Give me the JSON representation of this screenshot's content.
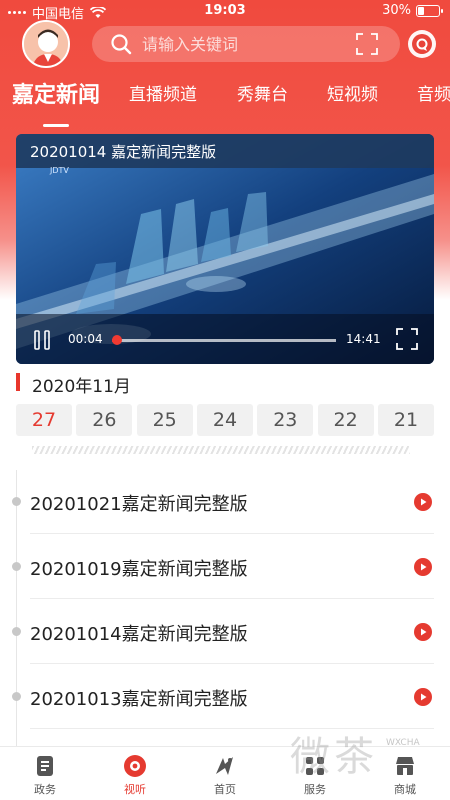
{
  "status_bar": {
    "carrier": "中国电信",
    "time": "19:03",
    "battery": "30%",
    "battery_level": 0.3
  },
  "search": {
    "placeholder": "请输入关键词"
  },
  "tabs": [
    {
      "label": "嘉定新闻",
      "active": true
    },
    {
      "label": "直播频道",
      "active": false
    },
    {
      "label": "秀舞台",
      "active": false
    },
    {
      "label": "短视频",
      "active": false
    },
    {
      "label": "音频",
      "active": false
    }
  ],
  "video": {
    "title": "20201014 嘉定新闻完整版",
    "logo_text": "JDTV",
    "current_time": "00:04",
    "total_time": "14:41",
    "progress": 0.005,
    "buffered": 0.3
  },
  "month": "2020年11月",
  "dates": [
    {
      "day": "27",
      "active": true
    },
    {
      "day": "26",
      "active": false
    },
    {
      "day": "25",
      "active": false
    },
    {
      "day": "24",
      "active": false
    },
    {
      "day": "23",
      "active": false
    },
    {
      "day": "22",
      "active": false
    },
    {
      "day": "21",
      "active": false
    }
  ],
  "news": [
    {
      "title": "20201021嘉定新闻完整版"
    },
    {
      "title": "20201019嘉定新闻完整版"
    },
    {
      "title": "20201014嘉定新闻完整版"
    },
    {
      "title": "20201013嘉定新闻完整版"
    }
  ],
  "bottom_nav": [
    {
      "label": "政务",
      "icon": "document-icon",
      "active": false
    },
    {
      "label": "视听",
      "icon": "play-disc-icon",
      "active": true
    },
    {
      "label": "首页",
      "icon": "home-logo-icon",
      "active": false
    },
    {
      "label": "服务",
      "icon": "grid-icon",
      "active": false
    },
    {
      "label": "商城",
      "icon": "shop-icon",
      "active": false
    }
  ],
  "watermark": {
    "text": "微茶",
    "sub": "WXCHA"
  },
  "colors": {
    "brand_red": "#e8362c",
    "active_date": "#e53a30",
    "gray_bg": "#f1f1f1"
  }
}
